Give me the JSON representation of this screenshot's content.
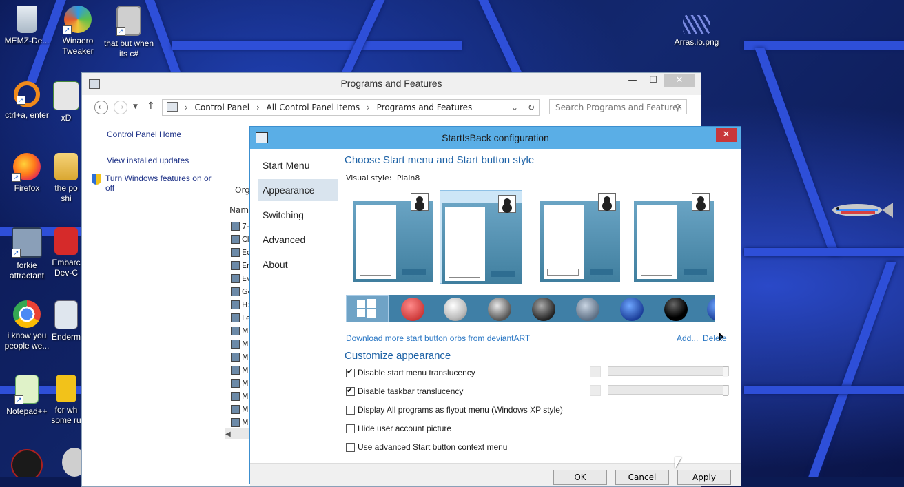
{
  "desktop": {
    "icons": [
      {
        "label": "MEMZ-De...",
        "icon": "recycle-bin-icon"
      },
      {
        "label": "Winaero Tweaker",
        "icon": "winaero-icon"
      },
      {
        "label": "that but when its c#",
        "icon": "files-icon"
      },
      {
        "label": "Arras.io.png",
        "icon": "image-icon"
      },
      {
        "label": "ctrl+a, enter",
        "icon": "search-icon"
      },
      {
        "label": "xD",
        "icon": "hex-icon"
      },
      {
        "label": "Firefox",
        "icon": "firefox-icon"
      },
      {
        "label": "the po shi",
        "icon": "folder-icon"
      },
      {
        "label": "forkie attractant",
        "icon": "gear-icon"
      },
      {
        "label": "Embarc Dev-C",
        "icon": "devcpp-icon"
      },
      {
        "label": "i know you people we...",
        "icon": "chrome-icon"
      },
      {
        "label": "Enderm",
        "icon": "window-icon"
      },
      {
        "label": "Notepad++",
        "icon": "notepadpp-icon"
      },
      {
        "label": "for wh some ru",
        "icon": "document-icon"
      }
    ]
  },
  "programs_window": {
    "title": "Programs and Features",
    "minimize": "—",
    "maximize": "☐",
    "close": "✕",
    "breadcrumb": [
      "Control Panel",
      "All Control Panel Items",
      "Programs and Features"
    ],
    "search_placeholder": "Search Programs and Features",
    "left_nav": [
      "Control Panel Home",
      "View installed updates",
      "Turn Windows features on or off"
    ],
    "organize": "Orga",
    "name_col": "Name",
    "rows": [
      "7-",
      "Cl",
      "Ec",
      "Er",
      "Ev",
      "Gc",
      "H:",
      "Le",
      "M",
      "M",
      "M",
      "M",
      "M",
      "M",
      "M",
      "M"
    ]
  },
  "startisback": {
    "title": "StartIsBack configuration",
    "close": "✕",
    "sidebar": [
      "Start Menu",
      "Appearance",
      "Switching",
      "Advanced",
      "About"
    ],
    "active_tab": "Appearance",
    "heading": "Choose Start menu and Start button style",
    "visual_style_label": "Visual style:",
    "visual_style_value": "Plain8",
    "selected_style_index": 1,
    "orbs_link": "Download more start button orbs from deviantART",
    "add_link": "Add...",
    "delete_link": "Delete",
    "customize_heading": "Customize appearance",
    "options": [
      {
        "label": "Disable start menu translucency",
        "checked": true
      },
      {
        "label": "Disable taskbar translucency",
        "checked": true
      },
      {
        "label": "Display All programs as flyout menu (Windows XP style)",
        "checked": false
      },
      {
        "label": "Hide user account picture",
        "checked": false
      },
      {
        "label": "Use advanced Start button context menu",
        "checked": false
      }
    ],
    "buttons": [
      "OK",
      "Cancel",
      "Apply"
    ]
  }
}
